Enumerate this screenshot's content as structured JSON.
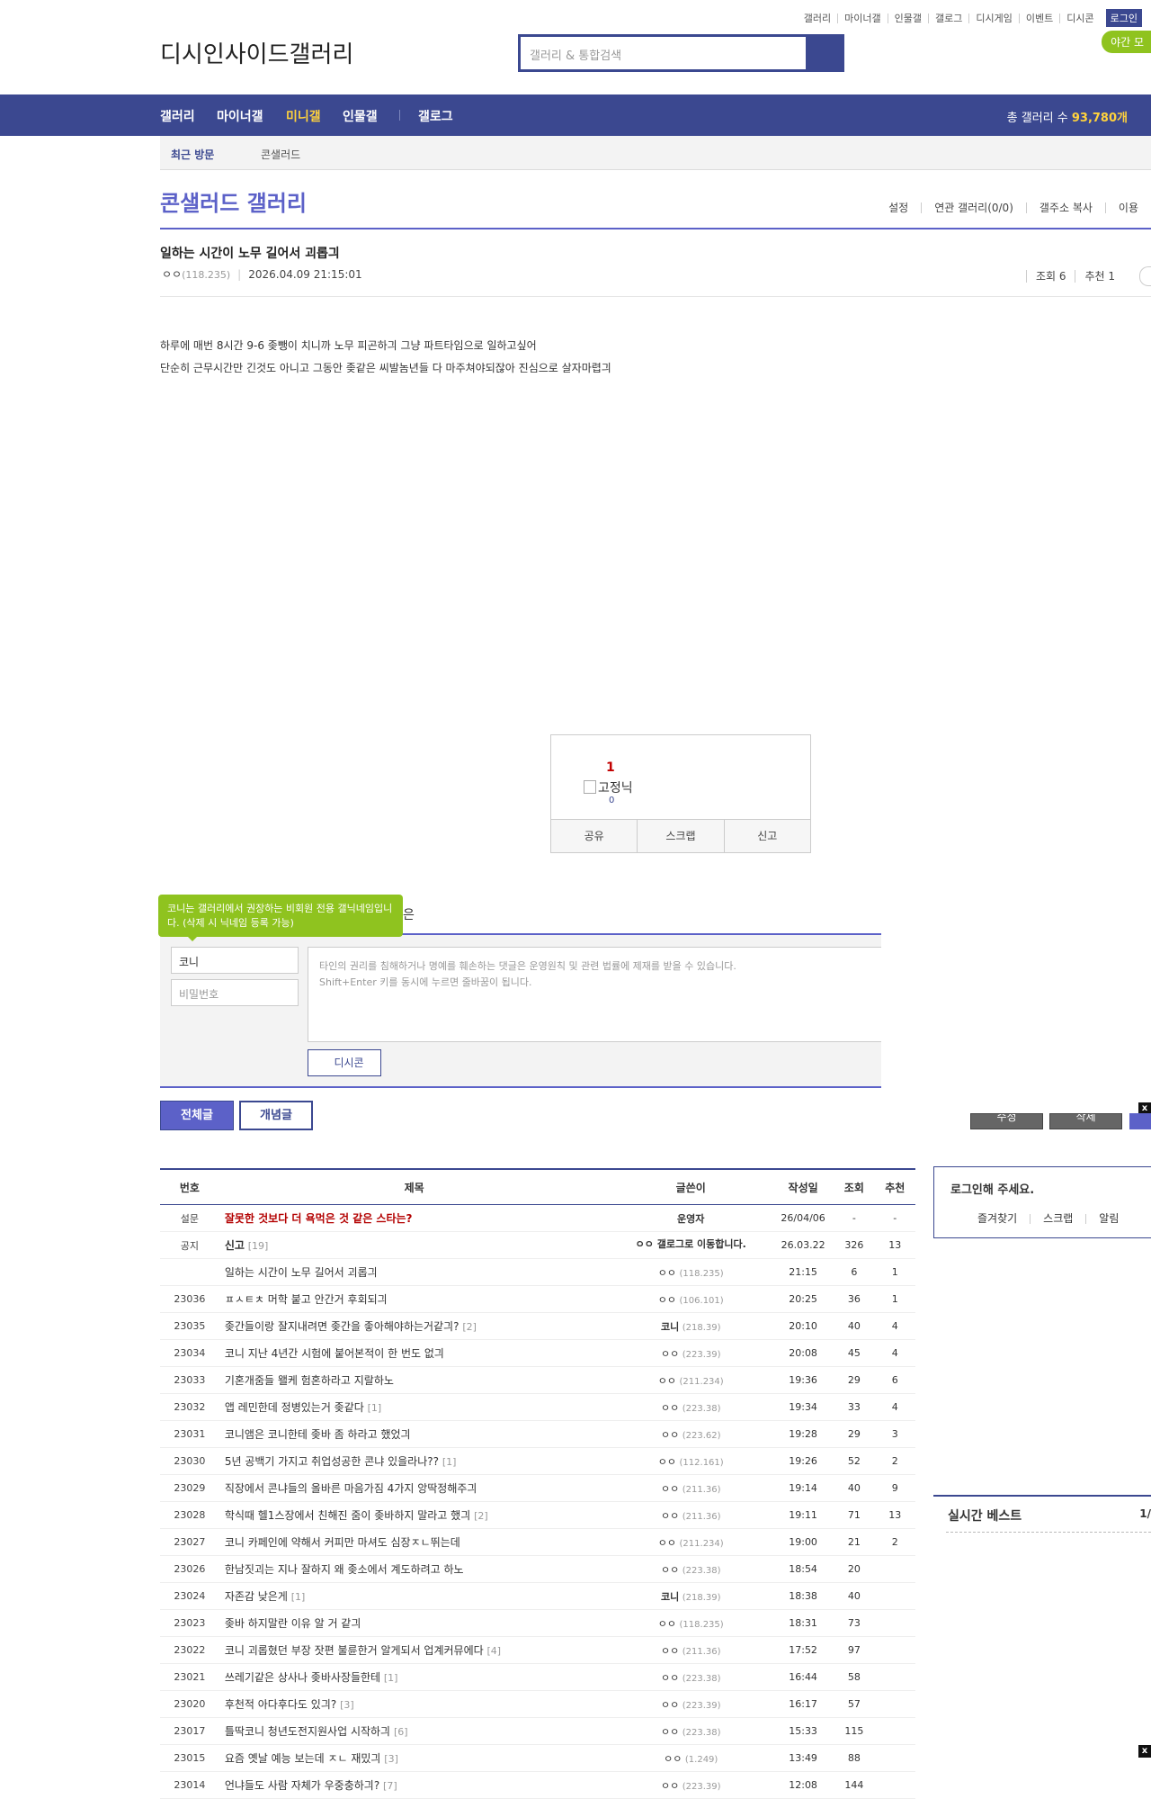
{
  "util": {
    "links": [
      "갤러리",
      "마이너갤",
      "인물갤",
      "갤로그",
      "디시게임",
      "이벤트",
      "디시콘"
    ],
    "login": "로그인",
    "night_mode": "야간 모"
  },
  "header": {
    "logo_text": "디시인사이드갤러리",
    "search_placeholder": "갤러리 & 통합검색"
  },
  "gnb": {
    "items": [
      "갤러리",
      "마이너갤",
      "미니갤",
      "인물갤",
      "갤로그"
    ],
    "active": "미니갤",
    "total_label": "총 갤러리 수",
    "total_value": "93,780개"
  },
  "visit": {
    "recent": "최근 방문",
    "item": "콘샐러드"
  },
  "gallery": {
    "title": "콘샐러드 갤러리",
    "menu": [
      "설정",
      "연관 갤러리(0/0)",
      "갤주소 복사",
      "이용"
    ]
  },
  "post": {
    "title": "일하는 시간이 노무 길어서 괴롭긔",
    "author": "ㅇㅇ",
    "ip": "(118.235)",
    "date": "2026.04.09 21:15:01",
    "views": "조회 6",
    "recommend": "추천 1",
    "body": [
      "하루에 매번 8시간 9-6 좆뺑이 치니까 노무 피곤하긔 그냥 파트타임으로 일하고싶어",
      "단순히 근무시간만 긴것도 아니고 그동안 좆같은 씨발놈년들 다 마주쳐야되잖아 진심으로 살자마렵긔"
    ]
  },
  "recommend_box": {
    "count": "1",
    "img_alt": "고정닉",
    "fixed_count": "0",
    "buttons": [
      "공유",
      "스크랩",
      "신고"
    ]
  },
  "comment": {
    "tip": "코니는 갤러리에서 권장하는 비회원 전용 갤닉네임입니다. (삭제 시 닉네임 등록 가능)",
    "partial_label": "은",
    "name_value": "코니",
    "password_placeholder": "비밀번호",
    "textarea_line1": "타인의 권리를 침해하거나 명예를 훼손하는 댓글은 운영원칙 및 관련 법률에 제재를 받을 수 있습니다.",
    "textarea_line2": "Shift+Enter 키를 동시에 누르면 줄바꿈이 됩니다.",
    "dccon": "디시콘"
  },
  "list_tabs": {
    "all": "전체글",
    "concept": "개념글"
  },
  "overlay": {
    "close": "x",
    "btn1": "수정",
    "btn2": "삭제"
  },
  "list": {
    "headers": [
      "번호",
      "제목",
      "글쓴이",
      "작성일",
      "조회",
      "추천"
    ],
    "rows": [
      {
        "num": "설문",
        "title": "잘못한 것보다 더 욕먹은 것 같은 스타는?",
        "comments": "",
        "writer": "운영자",
        "ip": "",
        "date": "26/04/06",
        "views": "-",
        "rec": "-",
        "style": "survey"
      },
      {
        "num": "공지",
        "title": "신고",
        "comments": "[19]",
        "writer": "ㅇㅇ 갤로그로 이동합니다.",
        "ip": "",
        "date": "26.03.22",
        "views": "326",
        "rec": "13",
        "style": "notice"
      },
      {
        "num": "",
        "title": "일하는 시간이 노무 길어서 괴롭긔",
        "comments": "",
        "writer": "ㅇㅇ",
        "ip": "(118.235)",
        "date": "21:15",
        "views": "6",
        "rec": "1",
        "style": ""
      },
      {
        "num": "23036",
        "title": "ㅍㅅㅌㅊ 머학 붙고 안간거 후회되긔",
        "comments": "",
        "writer": "ㅇㅇ",
        "ip": "(106.101)",
        "date": "20:25",
        "views": "36",
        "rec": "1",
        "style": ""
      },
      {
        "num": "23035",
        "title": "좆간들이랑 잘지내려면 좆간을 좋아해야하는거같긔?",
        "comments": "[2]",
        "writer": "코니",
        "ip": "(218.39)",
        "date": "20:10",
        "views": "40",
        "rec": "4",
        "style": "konis"
      },
      {
        "num": "23034",
        "title": "코니 지난 4년간 시험에 붙어본적이 한 번도 없긔",
        "comments": "",
        "writer": "ㅇㅇ",
        "ip": "(223.39)",
        "date": "20:08",
        "views": "45",
        "rec": "4",
        "style": ""
      },
      {
        "num": "23033",
        "title": "기혼개줌들 왤케 험혼하라고 지랄하노",
        "comments": "",
        "writer": "ㅇㅇ",
        "ip": "(211.234)",
        "date": "19:36",
        "views": "29",
        "rec": "6",
        "style": ""
      },
      {
        "num": "23032",
        "title": "앱 레민한데 정병있는거 좆같다",
        "comments": "[1]",
        "writer": "ㅇㅇ",
        "ip": "(223.38)",
        "date": "19:34",
        "views": "33",
        "rec": "4",
        "style": ""
      },
      {
        "num": "23031",
        "title": "코니앰은 코니한테 좆바 좀 하라고 했었긔",
        "comments": "",
        "writer": "ㅇㅇ",
        "ip": "(223.62)",
        "date": "19:28",
        "views": "29",
        "rec": "3",
        "style": ""
      },
      {
        "num": "23030",
        "title": "5년 공백기 가지고 취업성공한 콘냐 있을라나??",
        "comments": "[1]",
        "writer": "ㅇㅇ",
        "ip": "(112.161)",
        "date": "19:26",
        "views": "52",
        "rec": "2",
        "style": ""
      },
      {
        "num": "23029",
        "title": "직장에서 콘냐들의 올바른 마음가짐 4가지 앙딱정해주긔",
        "comments": "",
        "writer": "ㅇㅇ",
        "ip": "(211.36)",
        "date": "19:14",
        "views": "40",
        "rec": "9",
        "style": ""
      },
      {
        "num": "23028",
        "title": "학식때 헬1스장에서 친해진 줌이 좆바하지 말라고 했긔",
        "comments": "[2]",
        "writer": "ㅇㅇ",
        "ip": "(211.36)",
        "date": "19:11",
        "views": "71",
        "rec": "13",
        "style": ""
      },
      {
        "num": "23027",
        "title": "코니 카페인에 약해서 커피만 마셔도 심장ㅈㄴ뛰는데",
        "comments": "",
        "writer": "ㅇㅇ",
        "ip": "(211.234)",
        "date": "19:00",
        "views": "21",
        "rec": "2",
        "style": ""
      },
      {
        "num": "23026",
        "title": "한남짓괴는 지나 잘하지 왜 좆소에서 계도하려고 하노",
        "comments": "",
        "writer": "ㅇㅇ",
        "ip": "(223.38)",
        "date": "18:54",
        "views": "20",
        "rec": "",
        "style": ""
      },
      {
        "num": "23024",
        "title": "자존감 낮은게",
        "comments": "[1]",
        "writer": "코니",
        "ip": "(218.39)",
        "date": "18:38",
        "views": "40",
        "rec": "",
        "style": "konis"
      },
      {
        "num": "23023",
        "title": "좆바 하지말란 이유 알 거 같긔",
        "comments": "",
        "writer": "ㅇㅇ",
        "ip": "(118.235)",
        "date": "18:31",
        "views": "73",
        "rec": "",
        "style": ""
      },
      {
        "num": "23022",
        "title": "코니 괴롭혔던 부장 잣편 불륜한거 알게되서 업계커뮤에다",
        "comments": "[4]",
        "writer": "ㅇㅇ",
        "ip": "(211.36)",
        "date": "17:52",
        "views": "97",
        "rec": "",
        "style": ""
      },
      {
        "num": "23021",
        "title": "쓰레기같은 상사나 좆바사장들한테",
        "comments": "[1]",
        "writer": "ㅇㅇ",
        "ip": "(223.38)",
        "date": "16:44",
        "views": "58",
        "rec": "",
        "style": ""
      },
      {
        "num": "23020",
        "title": "후천적 아다후다도 있긔?",
        "comments": "[3]",
        "writer": "ㅇㅇ",
        "ip": "(223.39)",
        "date": "16:17",
        "views": "57",
        "rec": "",
        "style": ""
      },
      {
        "num": "23017",
        "title": "틀딱코니 청년도전지원사업 시작하긔",
        "comments": "[6]",
        "writer": "ㅇㅇ",
        "ip": "(223.38)",
        "date": "15:33",
        "views": "115",
        "rec": "",
        "style": ""
      },
      {
        "num": "23015",
        "title": "요즘 옛날 예능 보는데 ㅈㄴ 재밌긔",
        "comments": "[3]",
        "writer": "ㅇㅇ",
        "ip": "(1.249)",
        "date": "13:49",
        "views": "88",
        "rec": "",
        "style": ""
      },
      {
        "num": "23014",
        "title": "언냐들도 사람 자체가 우중충하긔?",
        "comments": "[7]",
        "writer": "ㅇㅇ",
        "ip": "(223.39)",
        "date": "12:08",
        "views": "144",
        "rec": "",
        "style": ""
      }
    ]
  },
  "side": {
    "login_title": "로그인해 주세요.",
    "login_links": [
      "즐겨찾기",
      "스크랩",
      "알림"
    ],
    "best_title": "실시간 베스트",
    "best_page": "1/"
  }
}
